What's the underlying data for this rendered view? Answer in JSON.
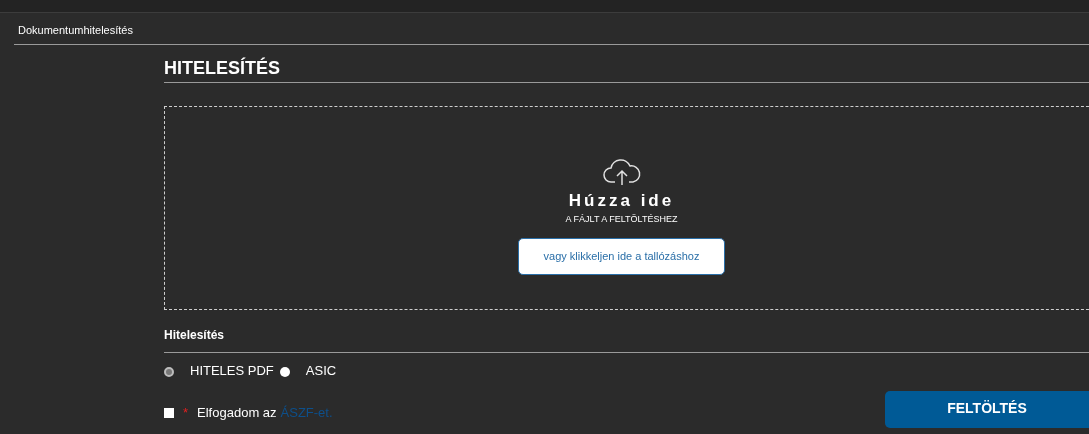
{
  "breadcrumb": "Dokumentumhitelesítés",
  "heading": "HITELESÍTÉS",
  "dropzone": {
    "title": "Húzza ide",
    "subtitle": "A FÁJLT A FELTÖLTÉSHEZ",
    "browse_button": "vagy klikkeljen ide a tallózáshoz"
  },
  "section_label": "Hitelesítés",
  "format_options": [
    {
      "label": "HITELES PDF",
      "selected": true
    },
    {
      "label": "ASIC",
      "selected": false
    }
  ],
  "terms": {
    "checked": false,
    "required_mark": "*",
    "text": "Elfogadom az",
    "link": "ÁSZF-et."
  },
  "upload_button": "FELTÖLTÉS"
}
